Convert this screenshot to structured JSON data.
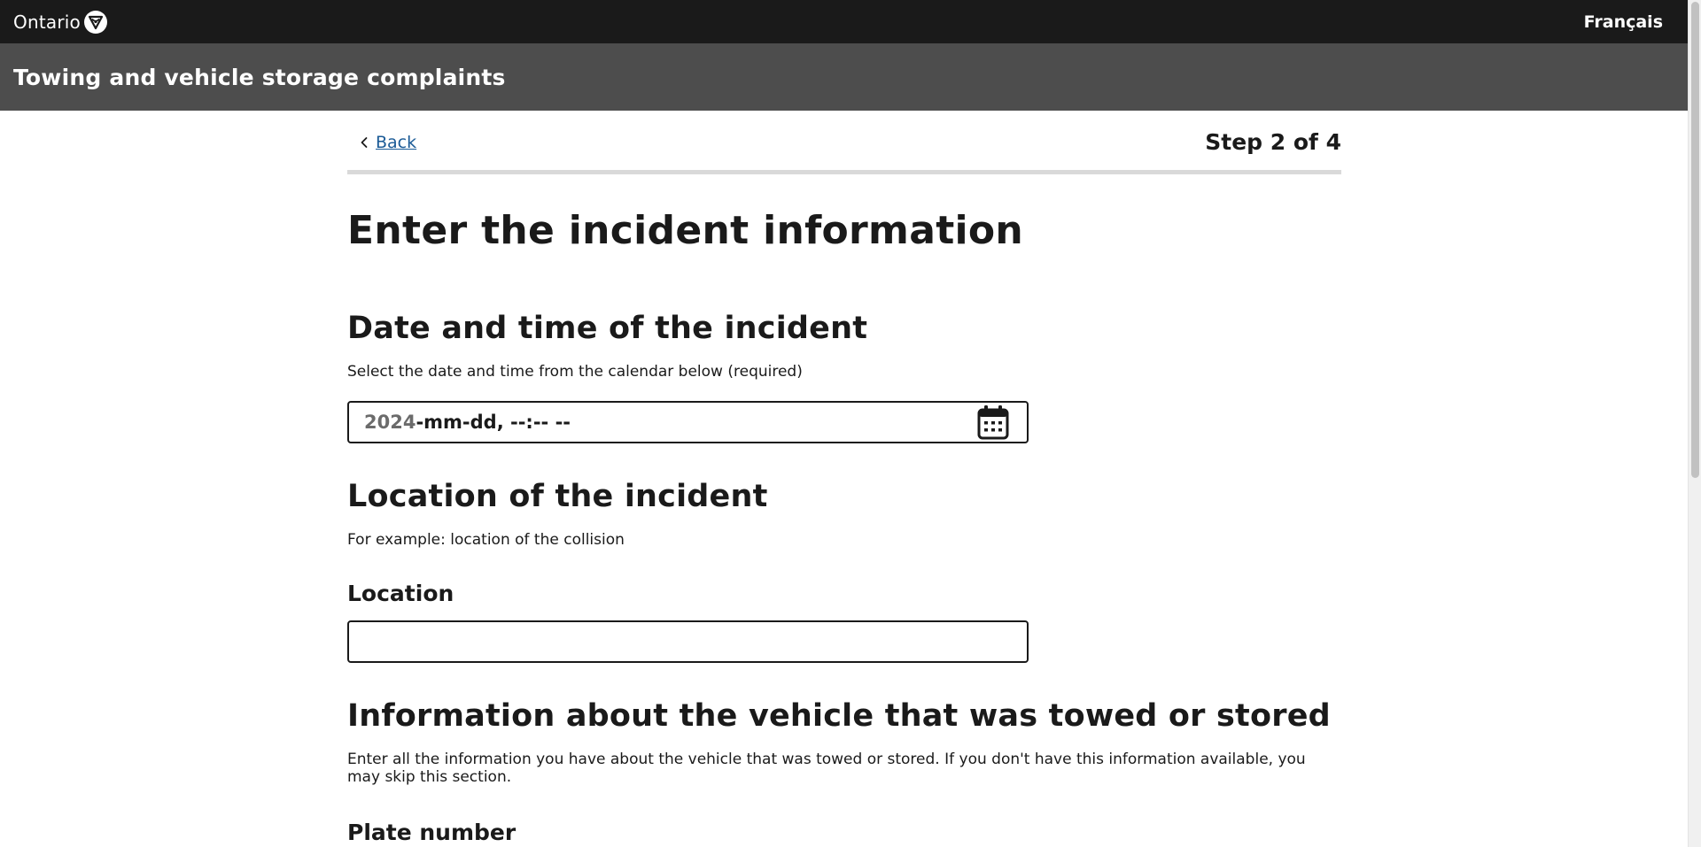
{
  "header": {
    "logo_text": "Ontario",
    "language_link": "Français",
    "service_title": "Towing and vehicle storage complaints"
  },
  "nav": {
    "back_label": "Back",
    "step_text": "Step 2 of 4"
  },
  "page": {
    "title": "Enter the incident information"
  },
  "sections": {
    "datetime": {
      "heading": "Date and time of the incident",
      "hint": "Select the date and time from the calendar below (required)",
      "value_year": "2024",
      "value_rest": "-mm-dd, --:-- --"
    },
    "location": {
      "heading": "Location of the incident",
      "hint": "For example: location of the collision",
      "field_label": "Location",
      "value": ""
    },
    "vehicle": {
      "heading": "Information about the vehicle that was towed or stored",
      "hint": "Enter all the information you have about the vehicle that was towed or stored. If you don't have this information available, you may skip this section.",
      "plate_label": "Plate number"
    }
  },
  "colors": {
    "topbar": "#1a1a1a",
    "servicebar": "#4d4d4d",
    "link": "#1a5a96",
    "divider": "#d9d9d9"
  },
  "icons": [
    "ontario-trillium-icon",
    "chevron-left-icon",
    "calendar-icon"
  ]
}
